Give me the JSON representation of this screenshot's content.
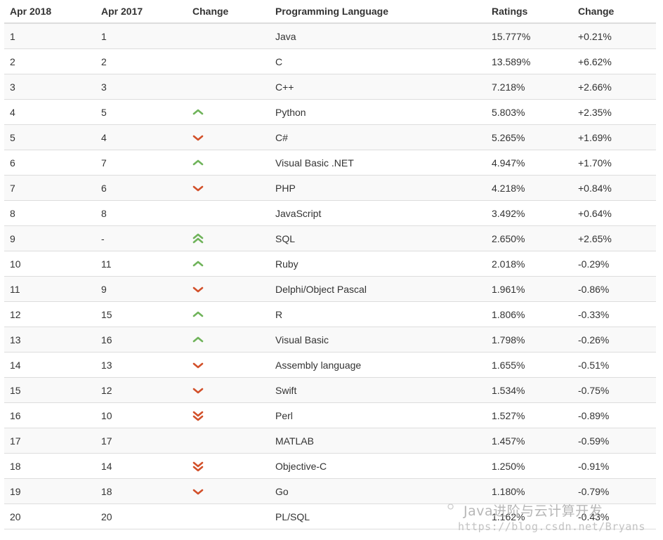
{
  "headers": {
    "rank_current": "Apr 2018",
    "rank_previous": "Apr 2017",
    "change": "Change",
    "language": "Programming Language",
    "ratings": "Ratings",
    "ratings_change": "Change"
  },
  "rows": [
    {
      "rank": "1",
      "prev": "1",
      "trend": "none",
      "language": "Java",
      "rating": "15.777%",
      "delta": "+0.21%"
    },
    {
      "rank": "2",
      "prev": "2",
      "trend": "none",
      "language": "C",
      "rating": "13.589%",
      "delta": "+6.62%"
    },
    {
      "rank": "3",
      "prev": "3",
      "trend": "none",
      "language": "C++",
      "rating": "7.218%",
      "delta": "+2.66%"
    },
    {
      "rank": "4",
      "prev": "5",
      "trend": "up",
      "language": "Python",
      "rating": "5.803%",
      "delta": "+2.35%"
    },
    {
      "rank": "5",
      "prev": "4",
      "trend": "down",
      "language": "C#",
      "rating": "5.265%",
      "delta": "+1.69%"
    },
    {
      "rank": "6",
      "prev": "7",
      "trend": "up",
      "language": "Visual Basic .NET",
      "rating": "4.947%",
      "delta": "+1.70%"
    },
    {
      "rank": "7",
      "prev": "6",
      "trend": "down",
      "language": "PHP",
      "rating": "4.218%",
      "delta": "+0.84%"
    },
    {
      "rank": "8",
      "prev": "8",
      "trend": "none",
      "language": "JavaScript",
      "rating": "3.492%",
      "delta": "+0.64%"
    },
    {
      "rank": "9",
      "prev": "-",
      "trend": "double-up",
      "language": "SQL",
      "rating": "2.650%",
      "delta": "+2.65%"
    },
    {
      "rank": "10",
      "prev": "11",
      "trend": "up",
      "language": "Ruby",
      "rating": "2.018%",
      "delta": "-0.29%"
    },
    {
      "rank": "11",
      "prev": "9",
      "trend": "down",
      "language": "Delphi/Object Pascal",
      "rating": "1.961%",
      "delta": "-0.86%"
    },
    {
      "rank": "12",
      "prev": "15",
      "trend": "up",
      "language": "R",
      "rating": "1.806%",
      "delta": "-0.33%"
    },
    {
      "rank": "13",
      "prev": "16",
      "trend": "up",
      "language": "Visual Basic",
      "rating": "1.798%",
      "delta": "-0.26%"
    },
    {
      "rank": "14",
      "prev": "13",
      "trend": "down",
      "language": "Assembly language",
      "rating": "1.655%",
      "delta": "-0.51%"
    },
    {
      "rank": "15",
      "prev": "12",
      "trend": "down",
      "language": "Swift",
      "rating": "1.534%",
      "delta": "-0.75%"
    },
    {
      "rank": "16",
      "prev": "10",
      "trend": "double-down",
      "language": "Perl",
      "rating": "1.527%",
      "delta": "-0.89%"
    },
    {
      "rank": "17",
      "prev": "17",
      "trend": "none",
      "language": "MATLAB",
      "rating": "1.457%",
      "delta": "-0.59%"
    },
    {
      "rank": "18",
      "prev": "14",
      "trend": "double-down",
      "language": "Objective-C",
      "rating": "1.250%",
      "delta": "-0.91%"
    },
    {
      "rank": "19",
      "prev": "18",
      "trend": "down",
      "language": "Go",
      "rating": "1.180%",
      "delta": "-0.79%"
    },
    {
      "rank": "20",
      "prev": "20",
      "trend": "none",
      "language": "PL/SQL",
      "rating": "1.162%",
      "delta": "-0.43%"
    }
  ],
  "trend_icons": {
    "up": "chevron-up-icon",
    "down": "chevron-down-icon",
    "double-up": "double-chevron-up-icon",
    "double-down": "double-chevron-down-icon"
  },
  "colors": {
    "up": "#6fb35a",
    "down": "#d2502a",
    "stripe": "#f9f9f9",
    "border": "#dddddd"
  },
  "watermark": {
    "title": "Java进阶与云计算开发",
    "url": "https://blog.csdn.net/Bryans"
  }
}
